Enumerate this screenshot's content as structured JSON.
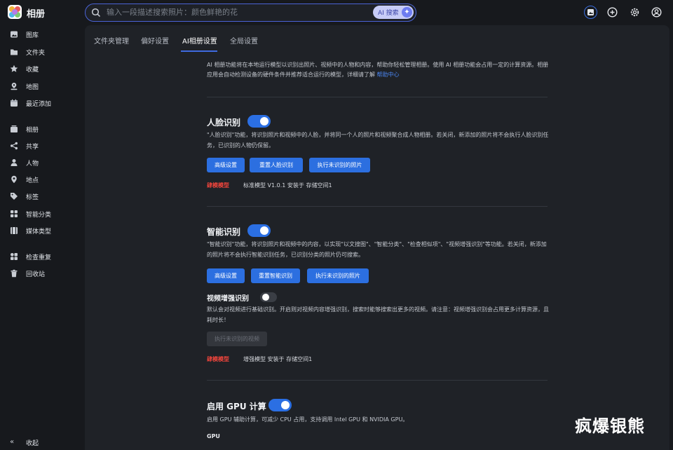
{
  "app": {
    "title": "相册"
  },
  "search": {
    "placeholder": "输入一段描述搜索照片：颜色鲜艳的花",
    "ai_label": "AI 搜索"
  },
  "top_icons": [
    "photo-upload-icon",
    "plus-circle-icon",
    "gear-icon",
    "user-circle-icon"
  ],
  "sidebar": {
    "items": [
      {
        "label": "图库",
        "icon": "image-icon"
      },
      {
        "label": "文件夹",
        "icon": "folder-icon"
      },
      {
        "label": "收藏",
        "icon": "star-icon"
      },
      {
        "label": "地图",
        "icon": "map-pin-icon"
      },
      {
        "label": "最近添加",
        "icon": "calendar-icon"
      },
      {
        "label": "相册",
        "icon": "album-icon"
      },
      {
        "label": "共享",
        "icon": "share-icon"
      },
      {
        "label": "人物",
        "icon": "person-icon"
      },
      {
        "label": "地点",
        "icon": "location-icon"
      },
      {
        "label": "标签",
        "icon": "tag-icon"
      },
      {
        "label": "智能分类",
        "icon": "grid-icon"
      },
      {
        "label": "媒体类型",
        "icon": "media-icon"
      },
      {
        "label": "检查重复",
        "icon": "duplicate-icon"
      },
      {
        "label": "回收站",
        "icon": "trash-icon"
      }
    ],
    "collapse_label": "收起"
  },
  "tabs": [
    "文件夹管理",
    "偏好设置",
    "AI相册设置",
    "全局设置"
  ],
  "active_tab": "AI相册设置",
  "intro": {
    "text": "AI 相册功能将在本地运行模型以识别出照片、视频中的人物和内容，帮助你轻松管理相册。使用 AI 相册功能会占用一定的计算资源。相册应用会自动检测设备的硬件条件并推荐适合运行的模型，详细请了解",
    "link": "帮助中心"
  },
  "face": {
    "title": "人脸识别",
    "enabled": true,
    "desc": "\"人脸识别\"功能，将识别照片和视频中的人脸，并将同一个人的照片和视频聚合成人物相册。若关闭，新添加的照片将不会执行人脸识别任务，已识别的人物仍保留。",
    "buttons": [
      "高级设置",
      "重置人脸识别",
      "执行未识别的照片"
    ],
    "model_tag": "肆模模型",
    "model_info": "标准模型 V1.0.1 安装于 存储空间1"
  },
  "smart": {
    "title": "智能识别",
    "enabled": true,
    "desc": "\"智能识别\"功能，将识别照片和视频中的内容，以实现\"以文搜图\"、\"智能分类\"、\"检查相似项\"、\"视频增强识别\"等功能。若关闭，新添加的照片将不会执行智能识别任务，已识别分类的照片仍可搜索。",
    "buttons": [
      "高级设置",
      "重置智能识别",
      "执行未识别的照片"
    ],
    "video": {
      "title": "视频增强识别",
      "enabled": false,
      "desc": "默认会对视频进行基础识别。开启则对视频内容增强识别，搜索时能够搜索出更多的视频。请注意：视频增强识别会占用更多计算资源，且耗时长！",
      "button": "执行未识别的视频"
    },
    "model_tag": "肆模模型",
    "model_info": "增强模型 安装于 存储空间1"
  },
  "gpu": {
    "title": "启用 GPU 计算",
    "enabled": true,
    "desc": "启用 GPU 辅助计算，可减少 CPU 占用，支持调用 Intel GPU 和 NVIDIA GPU。",
    "label": "GPU"
  },
  "watermark": "疯爆银熊",
  "colors": {
    "accent": "#2c6fe0",
    "warning": "#f0453c",
    "background": "#17191d",
    "panel": "#1f2227"
  }
}
